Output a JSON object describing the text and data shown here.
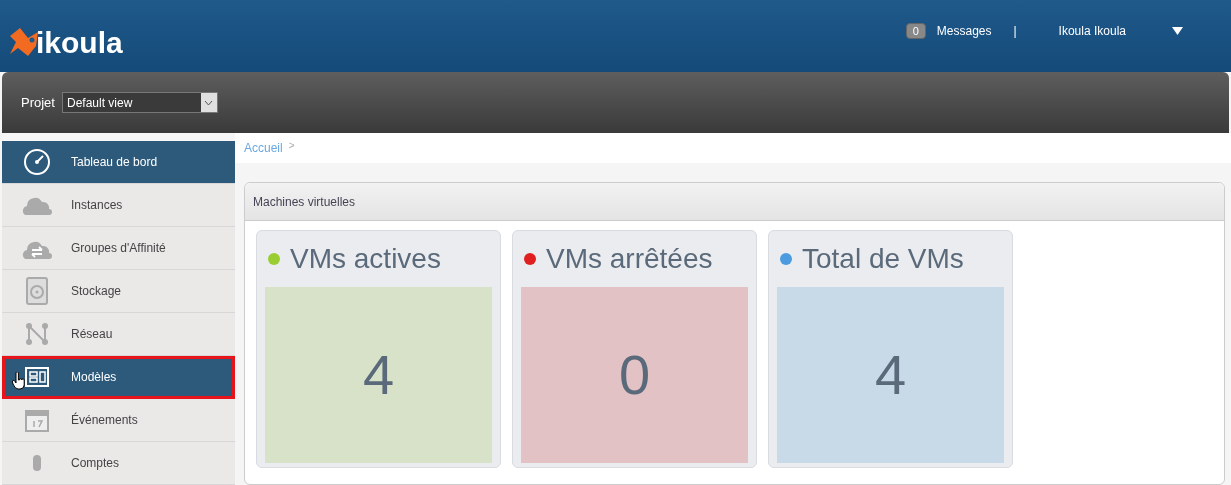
{
  "header": {
    "logo": "ikoula",
    "messages_count": "0",
    "messages_label": "Messages",
    "separator": "|",
    "user": "Ikoula Ikoula"
  },
  "toolbar": {
    "project_label": "Projet",
    "project_value": "Default view"
  },
  "sidebar": {
    "items": [
      {
        "label": "Tableau de bord",
        "kind": "gauge",
        "highlighted": true,
        "pointer": false,
        "outlined": false
      },
      {
        "label": "Instances",
        "kind": "cloud",
        "highlighted": false,
        "pointer": false,
        "outlined": false
      },
      {
        "label": "Groupes d'Affinité",
        "kind": "cloud-swap",
        "highlighted": false,
        "pointer": false,
        "outlined": false
      },
      {
        "label": "Stockage",
        "kind": "disk",
        "highlighted": false,
        "pointer": false,
        "outlined": false
      },
      {
        "label": "Réseau",
        "kind": "network",
        "highlighted": false,
        "pointer": false,
        "outlined": false
      },
      {
        "label": "Modèles",
        "kind": "templates",
        "highlighted": true,
        "pointer": true,
        "outlined": true
      },
      {
        "label": "Événements",
        "kind": "calendar",
        "highlighted": false,
        "pointer": false,
        "outlined": false
      },
      {
        "label": "Comptes",
        "kind": "user",
        "highlighted": false,
        "pointer": false,
        "outlined": false
      }
    ]
  },
  "breadcrumb": {
    "items": [
      "Accueil"
    ],
    "separator": ">"
  },
  "panel": {
    "title": "Machines virtuelles",
    "cards": [
      {
        "title": "VMs actives",
        "value": "4",
        "color": "#9acd32"
      },
      {
        "title": "VMs arrêtées",
        "value": "0",
        "color": "#e02020"
      },
      {
        "title": "Total de VMs",
        "value": "4",
        "color": "#4a9be0"
      }
    ]
  }
}
